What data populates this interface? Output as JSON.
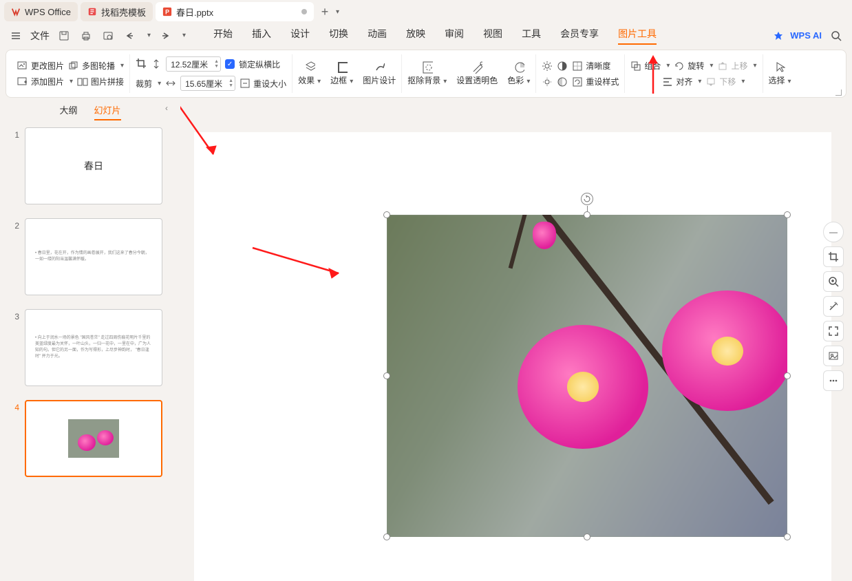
{
  "titlebar": {
    "app_tab": "WPS Office",
    "template_tab": "找稻壳模板",
    "doc_tab": "春日.pptx"
  },
  "menubar": {
    "file": "文件",
    "items": [
      "开始",
      "插入",
      "设计",
      "切换",
      "动画",
      "放映",
      "审阅",
      "视图",
      "工具",
      "会员专享",
      "图片工具"
    ],
    "active_index": 10,
    "ai": "WPS AI"
  },
  "ribbon": {
    "change_pic": "更改图片",
    "multi_outline": "多图轮播",
    "add_pic": "添加图片",
    "pic_join": "图片拼接",
    "crop": "裁剪",
    "height": "12.52厘米",
    "width": "15.65厘米",
    "lock_ratio": "锁定纵横比",
    "reset_size": "重设大小",
    "effect": "效果",
    "border": "边框",
    "pic_design": "图片设计",
    "remove_bg": "抠除背景",
    "set_trans": "设置透明色",
    "color": "色彩",
    "clear": "清晰度",
    "reset_style": "重设样式",
    "group": "组合",
    "rotate": "旋转",
    "align": "对齐",
    "up": "上移",
    "down": "下移",
    "select": "选择"
  },
  "sidepanel": {
    "outline": "大纲",
    "slides": "幻灯片",
    "slide1_title": "春日",
    "slide2_text": "春日里，花在开，作为情的画卷展开，我们这来了春分今朝，一如一缕的阳当温馨满怀暖。",
    "slide3_text": "向上于润水一场的景色 \"国风苍茫\" 走过四周伤痕花明片千里的美蓝绿度最为关怀，一叶山头，一归一花中，一里在中，广为人知的句。但它的另一面，作为写得形，上尽步神韵时， \"春日逢时\" 并力于光。",
    "slide_numbers": [
      "1",
      "2",
      "3",
      "4"
    ]
  }
}
